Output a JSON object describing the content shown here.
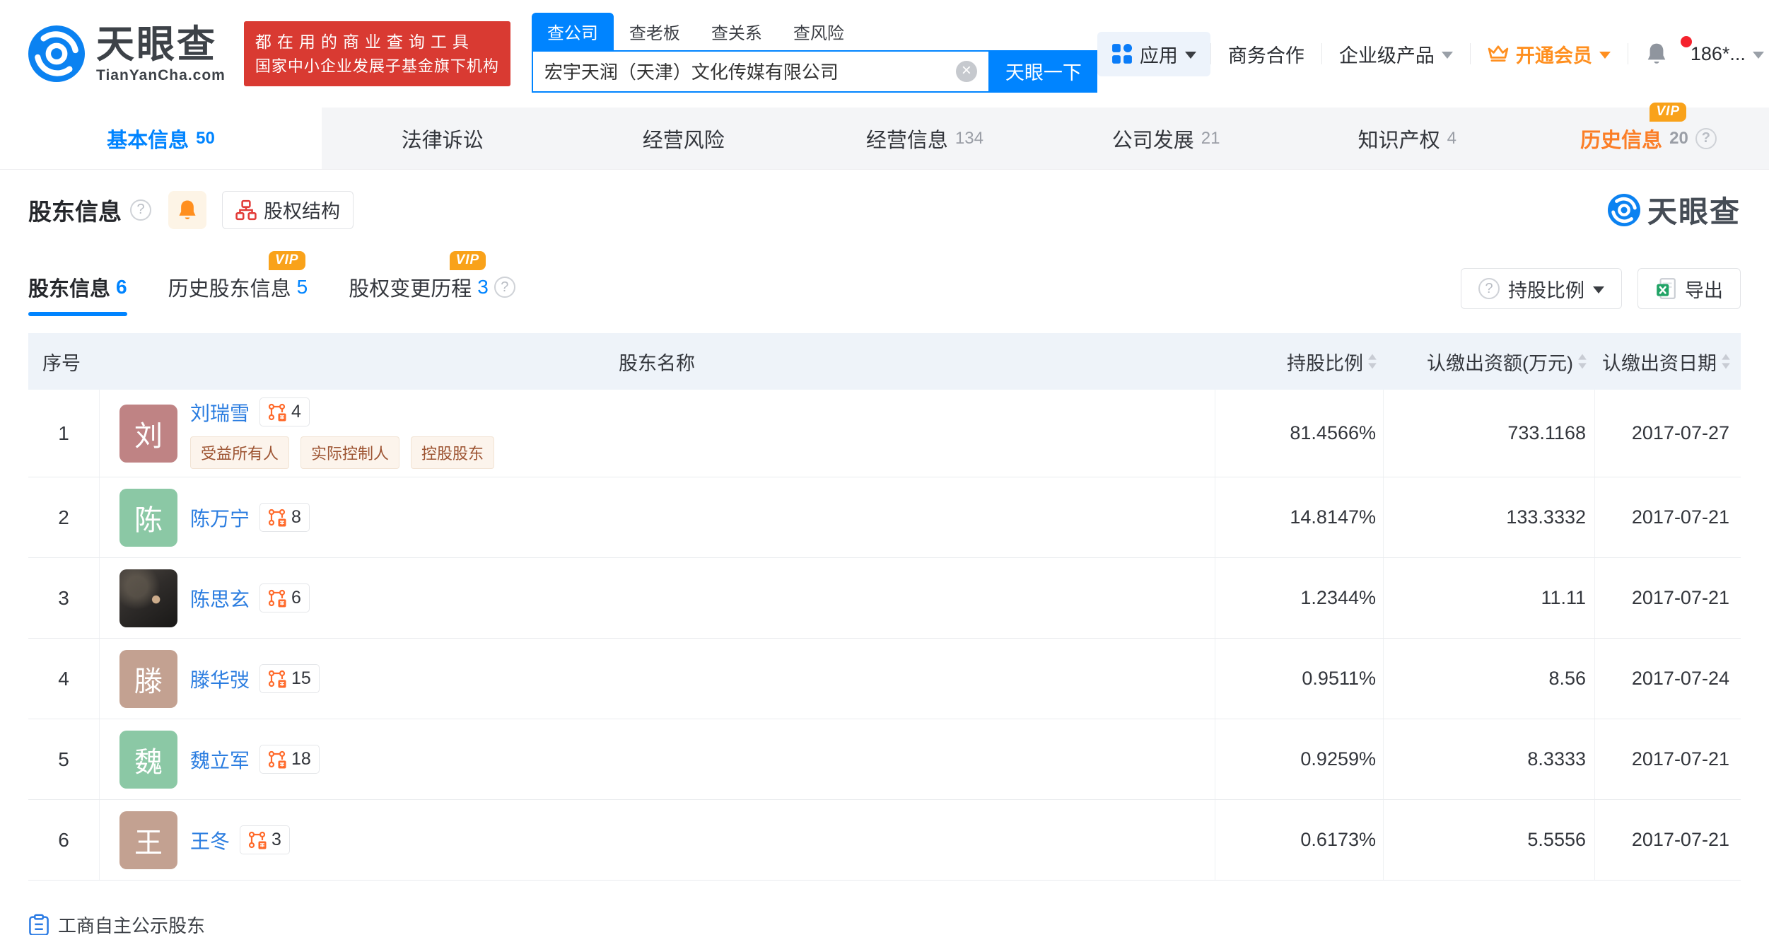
{
  "labels": {
    "vip": "VIP"
  },
  "icons": {
    "question": "?",
    "clear": "×"
  },
  "colors": {
    "brand_blue": "#0084ff",
    "link_blue": "#2b7de0",
    "banner_red": "#d93a32",
    "vip_orange": "#f9a21a",
    "member_orange": "#ff8f1f",
    "history_tab_orange": "#fb7e27",
    "tag_text": "#9d5432",
    "table_header_bg": "#eef3f9"
  },
  "header": {
    "logo": {
      "brand": "天眼查",
      "domain": "TianYanCha.com"
    },
    "banner": {
      "line1": "都在用的商业查询工具",
      "line2": "国家中小企业发展子基金旗下机构"
    },
    "search": {
      "tabs": [
        {
          "label": "查公司",
          "active": true
        },
        {
          "label": "查老板"
        },
        {
          "label": "查关系"
        },
        {
          "label": "查风险"
        }
      ],
      "value": "宏宇天润（天津）文化传媒有限公司",
      "button": "天眼一下"
    },
    "right": {
      "apps": "应用",
      "biz": "商务合作",
      "enterprise": "企业级产品",
      "vip": "开通会员",
      "user": "186*..."
    }
  },
  "nav": {
    "tabs": [
      {
        "label": "基本信息",
        "count": "50",
        "active": true
      },
      {
        "label": "法律诉讼"
      },
      {
        "label": "经营风险"
      },
      {
        "label": "经营信息",
        "count": "134"
      },
      {
        "label": "公司发展",
        "count": "21"
      },
      {
        "label": "知识产权",
        "count": "4"
      },
      {
        "label": "历史信息",
        "count": "20",
        "vip": true
      }
    ]
  },
  "section": {
    "title": "股东信息",
    "structure_button": "股权结构",
    "subtabs": [
      {
        "label": "股东信息",
        "count": "6",
        "active": true
      },
      {
        "label": "历史股东信息",
        "count": "5",
        "vip": true
      },
      {
        "label": "股权变更历程",
        "count": "3",
        "vip": true,
        "help": true
      }
    ],
    "sort_button": "持股比例",
    "export_button": "导出",
    "watermark": "天眼查"
  },
  "table": {
    "columns": [
      "序号",
      "股东名称",
      "持股比例",
      "认缴出资额(万元)",
      "认缴出资日期"
    ],
    "rows": [
      {
        "index": "1",
        "name": "刘瑞雪",
        "badge": "4",
        "avatar_char": "刘",
        "avatar_color": "#bf8384",
        "tags": [
          "受益所有人",
          "实际控制人",
          "控股股东"
        ],
        "ratio": "81.4566%",
        "amount": "733.1168",
        "date": "2017-07-27"
      },
      {
        "index": "2",
        "name": "陈万宁",
        "badge": "8",
        "avatar_char": "陈",
        "avatar_color": "#8bc8a5",
        "ratio": "14.8147%",
        "amount": "133.3332",
        "date": "2017-07-21"
      },
      {
        "index": "3",
        "name": "陈思玄",
        "badge": "6",
        "avatar_photo": true,
        "ratio": "1.2344%",
        "amount": "11.11",
        "date": "2017-07-21"
      },
      {
        "index": "4",
        "name": "滕华弢",
        "badge": "15",
        "avatar_char": "滕",
        "avatar_color": "#c3a191",
        "ratio": "0.9511%",
        "amount": "8.56",
        "date": "2017-07-24"
      },
      {
        "index": "5",
        "name": "魏立军",
        "badge": "18",
        "avatar_char": "魏",
        "avatar_color": "#8bc8a5",
        "ratio": "0.9259%",
        "amount": "8.3333",
        "date": "2017-07-21"
      },
      {
        "index": "6",
        "name": "王冬",
        "badge": "3",
        "avatar_char": "王",
        "avatar_color": "#c3a191",
        "ratio": "0.6173%",
        "amount": "5.5556",
        "date": "2017-07-21"
      }
    ],
    "footer_note": "工商自主公示股东"
  }
}
